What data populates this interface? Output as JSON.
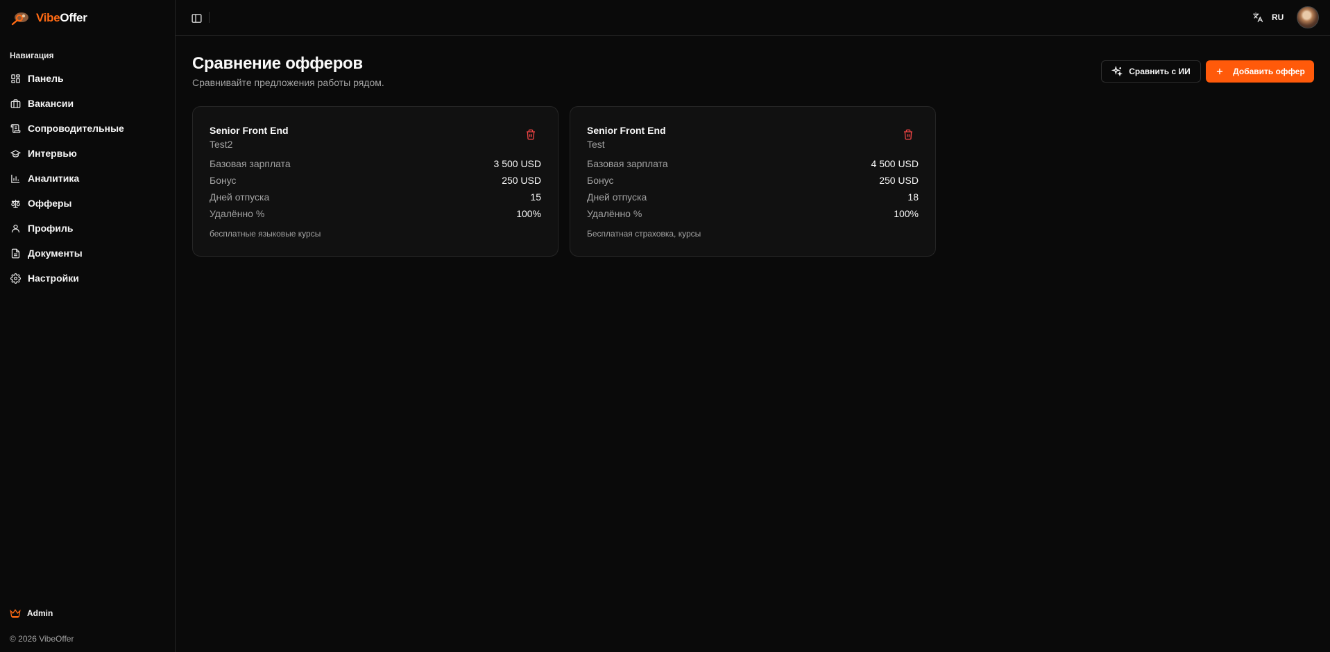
{
  "brand": {
    "name_part1": "Vibe",
    "name_part2": "Offer",
    "accent": "#ff6a13"
  },
  "sidebar": {
    "heading": "Навигация",
    "items": [
      {
        "label": "Панель",
        "icon": "dashboard-icon"
      },
      {
        "label": "Вакансии",
        "icon": "briefcase-icon"
      },
      {
        "label": "Сопроводительные",
        "icon": "scroll-icon"
      },
      {
        "label": "Интервью",
        "icon": "graduation-cap-icon"
      },
      {
        "label": "Аналитика",
        "icon": "bar-chart-icon"
      },
      {
        "label": "Офферы",
        "icon": "scale-icon"
      },
      {
        "label": "Профиль",
        "icon": "user-icon"
      },
      {
        "label": "Документы",
        "icon": "document-icon"
      },
      {
        "label": "Настройки",
        "icon": "settings-icon"
      }
    ],
    "admin_label": "Admin",
    "footer": "© 2026 VibeOffer"
  },
  "topbar": {
    "language": "RU"
  },
  "page": {
    "title": "Сравнение офферов",
    "subtitle": "Сравнивайте предложения работы рядом.",
    "compare_ai_label": "Сравнить с ИИ",
    "add_offer_label": "Добавить оффер"
  },
  "offers": [
    {
      "title": "Senior Front End",
      "company": "Test2",
      "rows": [
        {
          "label": "Базовая зарплата",
          "value": "3 500 USD"
        },
        {
          "label": "Бонус",
          "value": "250 USD"
        },
        {
          "label": "Дней отпуска",
          "value": "15"
        },
        {
          "label": "Удалённо %",
          "value": "100%"
        }
      ],
      "notes": "бесплатные языковые курсы"
    },
    {
      "title": "Senior Front End",
      "company": "Test",
      "rows": [
        {
          "label": "Базовая зарплата",
          "value": "4 500 USD"
        },
        {
          "label": "Бонус",
          "value": "250 USD"
        },
        {
          "label": "Дней отпуска",
          "value": "18"
        },
        {
          "label": "Удалённо %",
          "value": "100%"
        }
      ],
      "notes": "Бесплатная страховка, курсы"
    }
  ]
}
